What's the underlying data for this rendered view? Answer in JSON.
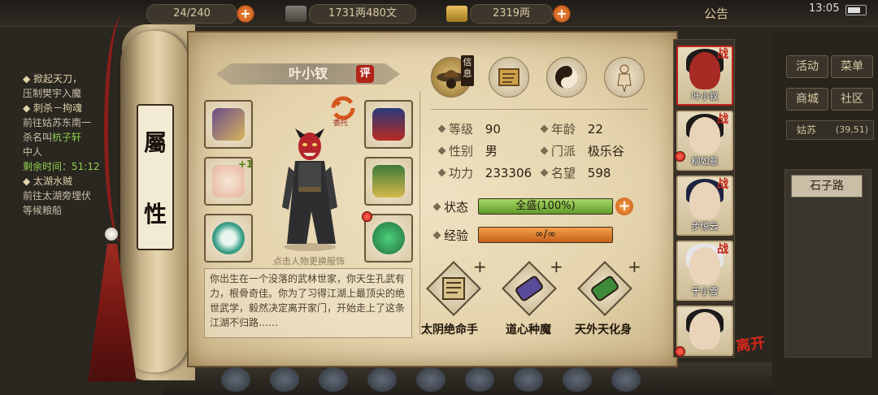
{
  "topbar": {
    "stamina": "24/240",
    "coins": "1731两480文",
    "gold": "2319两",
    "notice": "公告",
    "clock": "13:05"
  },
  "quests": [
    {
      "title": "◆ 掀起天刀，",
      "lines": [
        "压制樊宇入魔"
      ]
    },
    {
      "title": "◆ 刺杀－拘魂",
      "lines": [
        "前往姑苏东南一",
        "杀名叫",
        "中人"
      ],
      "link": "杭子轩",
      "remain_label": "剩余时间：",
      "remain": "51:12"
    },
    {
      "title": "◆ 太湖水贼",
      "lines": [
        "前往太湖旁埋伏",
        "等候粮船"
      ]
    }
  ],
  "rightpanel": {
    "buttons": [
      "活动",
      "菜单",
      "商城",
      "社区"
    ],
    "location": "姑苏",
    "coords": "(39,51)",
    "place": "石子路"
  },
  "scroll": {
    "char1": "屬",
    "char2": "性"
  },
  "hero": {
    "name": "叶小钗",
    "ping": "评",
    "entrust": "委托",
    "equip_plus": "+1",
    "hint": "点击人物更换服饰",
    "description": "你出生在一个没落的武林世家，你天生孔武有力，根骨奇佳。你为了习得江湖上最顶尖的绝世武学，毅然决定离开家门，开始走上了这条江湖不归路……"
  },
  "tabs": {
    "info": "信息"
  },
  "stats": {
    "level_label": "等级",
    "level": "90",
    "age_label": "年龄",
    "age": "22",
    "gender_label": "性别",
    "gender": "男",
    "sect_label": "门派",
    "sect": "极乐谷",
    "power_label": "功力",
    "power": "233306",
    "fame_label": "名望",
    "fame": "598",
    "status_label": "状态",
    "status": "全盛(100%)",
    "status_pct": 100,
    "exp_label": "经验",
    "exp": "∞/∞"
  },
  "skills": [
    "太阴绝命手",
    "道心种魔",
    "天外天化身"
  ],
  "skill_plus": "+",
  "party": [
    {
      "name": "叶小钗",
      "battle": "战",
      "active": true
    },
    {
      "name": "柳如意",
      "battle": "战",
      "active": false
    },
    {
      "name": "步惊云",
      "battle": "战",
      "active": false
    },
    {
      "name": "于小雪",
      "battle": "战",
      "active": false
    },
    {
      "name": "",
      "battle": "",
      "active": false
    }
  ],
  "leave": "离开",
  "colors": {
    "accent_red": "#c2231a",
    "parchment": "#e4d3ac",
    "status_green": "#5f9a2a",
    "exp_orange": "#c7621a"
  }
}
